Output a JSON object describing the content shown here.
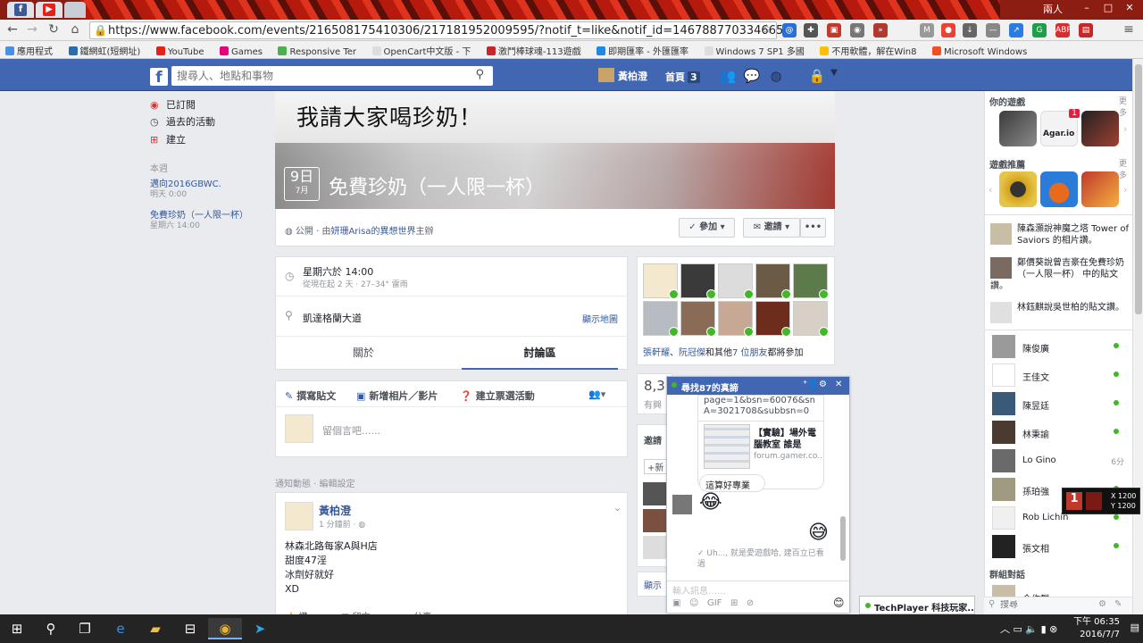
{
  "browser": {
    "window_label": "兩人",
    "url": "https://www.facebook.com/events/216508175410306/217181952009595/?notif_t=like&notif_id=1467887703346658",
    "bookmarks": [
      "應用程式",
      "鐵網虹(短網址)",
      "YouTube",
      "Games",
      "Responsive Ter",
      "OpenCart中文版 - 下",
      "激鬥棒球魂-113遊戲",
      "即期匯率 - 外匯匯率",
      "Windows 7 SP1 多國",
      "不用軟體，解在Win8",
      "Microsoft Windows"
    ]
  },
  "fb": {
    "search_placeholder": "搜尋人、地點和事物",
    "profile_name": "黃柏澄",
    "home_label": "首頁",
    "home_count": "3"
  },
  "left_nav": {
    "items": [
      "已訂閱",
      "過去的活動",
      "建立"
    ],
    "week_header": "本週",
    "events": [
      {
        "title": "邁向2016GBWC.",
        "time": "明天 0:00"
      },
      {
        "title": "免費珍奶（一人限一杯）",
        "time": "星期六 14:00"
      }
    ]
  },
  "event": {
    "cover_text": "我請大家喝珍奶！",
    "date_day": "9日",
    "date_month": "7月",
    "title": "免費珍奶（一人限一杯）",
    "privacy": "公開",
    "host_prefix": "由",
    "host_name": "妍珊Arisa的異想世界",
    "host_suffix": "主辦",
    "join_label": "參加",
    "invite_label": "邀請",
    "more_label": "•••",
    "time_main": "星期六於 14:00",
    "time_sub": "從現在起 2 天 · 27–34° 雷雨",
    "location": "凱達格蘭大道",
    "map_link": "顯示地圖",
    "tab_about": "關於",
    "tab_discussion": "討論區",
    "composer_write": "撰寫貼文",
    "composer_photo": "新增相片／影片",
    "composer_poll": "建立票選活動",
    "composer_placeholder": "留個言吧......",
    "notify_label": "通知動態",
    "notify_edit": "編輯設定",
    "post_author": "黃柏澄",
    "post_time": "1 分鐘前",
    "post_lines": [
      "林森北路每家A與H店",
      "甜度47淫",
      "冰劑好就好",
      "XD"
    ],
    "post_like": "讚",
    "post_comment": "留言",
    "post_share": "分享",
    "guests_text_1": "張軒耀",
    "guests_text_2": "阮冠傑",
    "guests_text_3": "和其他",
    "guests_text_4": "7 位朋友",
    "guests_text_5": "都將參加",
    "stub_count": "8,3",
    "stub_sub": "有興",
    "stub_invite": "邀請",
    "stub_new": "+新",
    "stub_show": "顯示"
  },
  "chat": {
    "title": "尋找87的真諦",
    "link_text": "page=1&bsn=60076&snA=3021708&subbsn=0",
    "card_title": "【實驗】場外電腦教室 誰是",
    "card_domain": "forum.gamer.co...",
    "msg1": "這算好專業",
    "emoji_in": "😂",
    "emoji_out": "😅",
    "seen_text": "Uh..., 就是愛遊戲哈, 建百立已看過",
    "input_placeholder": "輸入訊息……",
    "gif_label": "GIF"
  },
  "right": {
    "games_header": "你的遊戲",
    "more": "更多",
    "game_agar": "Agar.io",
    "game_badge": "1",
    "recommend_header": "遊戲推薦",
    "feed": [
      "陳森灝說神魔之塔 Tower of Saviors 的相片讚。",
      "鄭價葵說曾吉豪在免費珍奶（一人限一杯） 中的貼文讚。",
      "林鈺麒說吳世柏的貼文讚。"
    ],
    "friends": [
      {
        "name": "陳俊廣",
        "status": ""
      },
      {
        "name": "王佳文",
        "status": ""
      },
      {
        "name": "陳昱廷",
        "status": ""
      },
      {
        "name": "林秉諭",
        "status": ""
      },
      {
        "name": "Lo Gino",
        "status": "6分"
      },
      {
        "name": "孫珀強",
        "status": ""
      },
      {
        "name": "Rob Lichin",
        "status": ""
      },
      {
        "name": "張文相",
        "status": ""
      }
    ],
    "group_header": "群組對話",
    "group_item": "合作群",
    "search_placeholder": "搜尋"
  },
  "overlay": {
    "x": "X 1200",
    "y": "Y 1200"
  },
  "techplayer": "TechPlayer 科技玩家..",
  "taskbar": {
    "time": "下午 06:35",
    "date": "2016/7/7"
  },
  "colors": {
    "fb_blue": "#4267b2",
    "link": "#365899",
    "online": "#42b72a"
  }
}
